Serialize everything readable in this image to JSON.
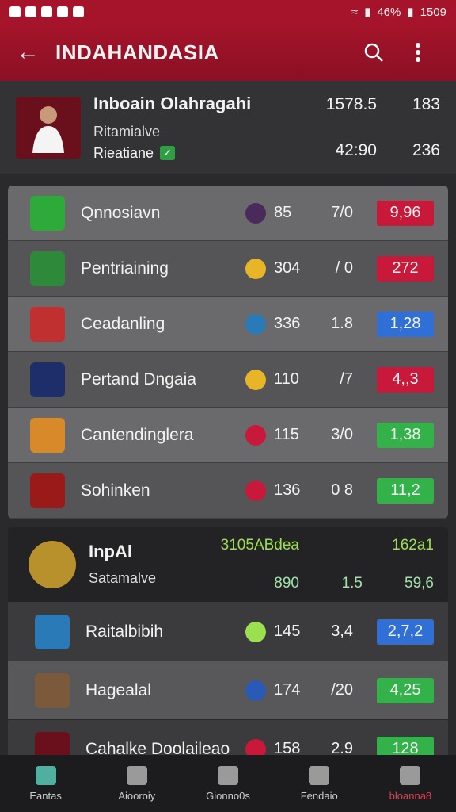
{
  "status_bar": {
    "battery": "46%",
    "time": "1509"
  },
  "app_bar": {
    "title": "INDAHANDASIA"
  },
  "profile": {
    "name": "Inboain Olahragahi",
    "subtitle": "Ritamialve",
    "status": "Rieatiane",
    "stat1a": "1578.5",
    "stat1b": "183",
    "stat2a": "42:90",
    "stat2b": "236"
  },
  "standings": [
    {
      "team": "Qnnosiavn",
      "v1": "85",
      "v2": "7/0",
      "badge": "9,96",
      "badge_color": "#c8193a",
      "crest_color": "#2eaa3a",
      "pill_color": "#4a2a5a"
    },
    {
      "team": "Pentriaining",
      "v1": "304",
      "v2": "/ 0",
      "badge": "272",
      "badge_color": "#c8193a",
      "crest_color": "#2e8a3a",
      "pill_color": "#e8b428"
    },
    {
      "team": "Ceadanling",
      "v1": "336",
      "v2": "1.8",
      "badge": "1,28",
      "badge_color": "#2f6fd6",
      "crest_color": "#c03030",
      "pill_color": "#2a7ab8"
    },
    {
      "team": "Pertand Dngaia",
      "v1": "110",
      "v2": "/7",
      "badge": "4,,3",
      "badge_color": "#c8193a",
      "crest_color": "#1e2e6a",
      "pill_color": "#e8b428"
    },
    {
      "team": "Cantendinglera",
      "v1": "115",
      "v2": "3/0",
      "badge": "1,38",
      "badge_color": "#34b24a",
      "crest_color": "#d88a2a",
      "pill_color": "#c8193a"
    },
    {
      "team": "Sohinken",
      "v1": "136",
      "v2": "0 8",
      "badge": "11,2",
      "badge_color": "#34b24a",
      "crest_color": "#9a1a1a",
      "pill_color": "#c8193a"
    }
  ],
  "featured": {
    "name": "InpAl",
    "subtitle": "Satamalve",
    "n1": "3105ABdea",
    "n2": "162a1",
    "n3": "890",
    "n4": "1.5",
    "n5": "59,6"
  },
  "standings2": [
    {
      "team": "Raitalbibih",
      "v1": "145",
      "v2": "3,4",
      "badge": "2,7,2",
      "badge_color": "#2f6fd6",
      "crest_color": "#2a7ab8",
      "pill_color": "#9be04f"
    },
    {
      "team": "Hagealal",
      "v1": "174",
      "v2": "/20",
      "badge": "4,25",
      "badge_color": "#34b24a",
      "crest_color": "#7a5a3a",
      "pill_color": "#2a5ab8"
    },
    {
      "team": "Cahalke Doolaileao",
      "v1": "158",
      "v2": "2.9",
      "badge": "128",
      "badge_color": "#34b24a",
      "crest_color": "#6a0f1c",
      "pill_color": "#c8193a"
    }
  ],
  "bottom_nav": [
    "Eantas",
    "Aiooroiy",
    "Gionno0s",
    "Fendaio",
    "bloanna8"
  ]
}
